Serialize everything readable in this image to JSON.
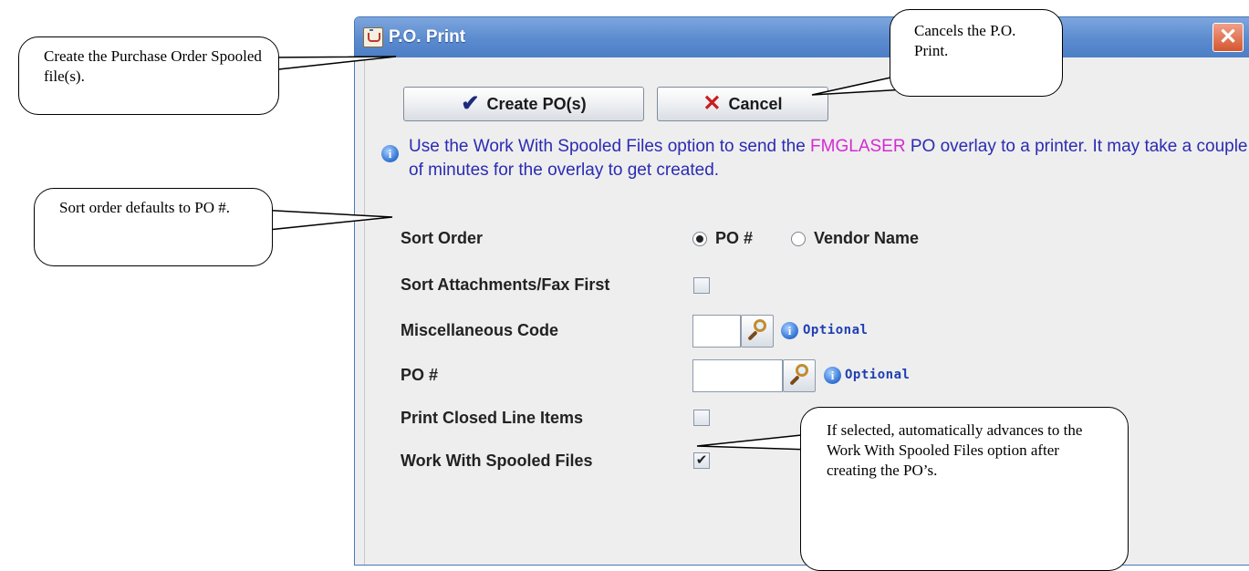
{
  "window": {
    "title": "P.O. Print",
    "close_label": "✕"
  },
  "toolbar": {
    "create_label": "Create PO(s)",
    "cancel_label": "Cancel"
  },
  "notice": {
    "text_before": "Use the Work With Spooled Files option to send the ",
    "highlight": "FMGLASER",
    "text_after": " PO overlay to a printer. It may take a couple of minutes for the overlay to get created."
  },
  "form": {
    "sort_order": {
      "label": "Sort Order",
      "options": [
        "PO #",
        "Vendor Name"
      ],
      "selected": "PO #"
    },
    "sort_attachments": {
      "label": "Sort Attachments/Fax First",
      "checked": false
    },
    "misc_code": {
      "label": "Miscellaneous Code",
      "value": "",
      "hint": "Optional"
    },
    "po_number": {
      "label": "PO #",
      "value": "",
      "hint": "Optional"
    },
    "print_closed": {
      "label": "Print Closed Line Items",
      "checked": false
    },
    "work_with_spooled": {
      "label": "Work With Spooled Files",
      "checked": true,
      "check_glyph": "✔"
    }
  },
  "callouts": {
    "create": "Create the Purchase Order Spooled file(s).",
    "cancel": "Cancels the P.O. Print.",
    "sort": "Sort order defaults to PO #.",
    "spooled": "If selected, automatically advances to the Work With Spooled Files option after creating the PO’s."
  },
  "colors": {
    "title_bar": "#5b8bcf",
    "notice_text": "#2b2bb3",
    "highlight": "#d42ad4",
    "optional_text": "#1f3fb0"
  },
  "icons": {
    "title": "java-cup-icon",
    "close": "close-icon",
    "create": "checkmark-icon",
    "cancel": "x-icon",
    "info": "info-icon",
    "lookup": "magnifier-icon"
  }
}
